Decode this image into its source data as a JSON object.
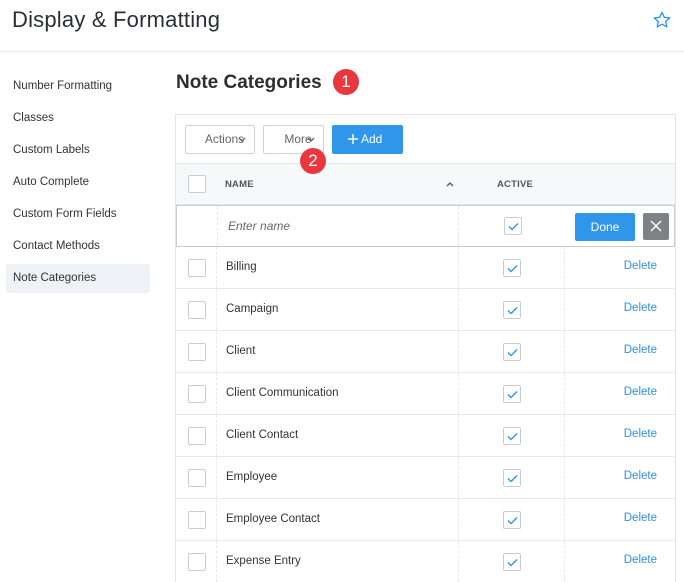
{
  "header": {
    "title": "Display & Formatting",
    "favorite_icon": "star-outline-icon"
  },
  "sidebar": {
    "items": [
      {
        "label": "Number Formatting",
        "active": false
      },
      {
        "label": "Classes",
        "active": false
      },
      {
        "label": "Custom Labels",
        "active": false
      },
      {
        "label": "Auto Complete",
        "active": false
      },
      {
        "label": "Custom Form Fields",
        "active": false
      },
      {
        "label": "Contact Methods",
        "active": false
      },
      {
        "label": "Note Categories",
        "active": true
      }
    ]
  },
  "main": {
    "title": "Note Categories",
    "badges": [
      "1",
      "2"
    ],
    "toolbar": {
      "actions_label": "Actions",
      "more_label": "More",
      "add_label": "Add"
    },
    "columns": {
      "name": "NAME",
      "active": "ACTIVE"
    },
    "edit_row": {
      "placeholder": "Enter name",
      "active": true,
      "done_label": "Done"
    },
    "delete_label": "Delete",
    "rows": [
      {
        "name": "Billing",
        "active": true
      },
      {
        "name": "Campaign",
        "active": true
      },
      {
        "name": "Client",
        "active": true
      },
      {
        "name": "Client Communication",
        "active": true
      },
      {
        "name": "Client Contact",
        "active": true
      },
      {
        "name": "Employee",
        "active": true
      },
      {
        "name": "Employee Contact",
        "active": true
      },
      {
        "name": "Expense Entry",
        "active": true
      }
    ]
  },
  "colors": {
    "accent": "#2f96ea",
    "badge": "#e8383d",
    "link": "#2f8fe0"
  }
}
